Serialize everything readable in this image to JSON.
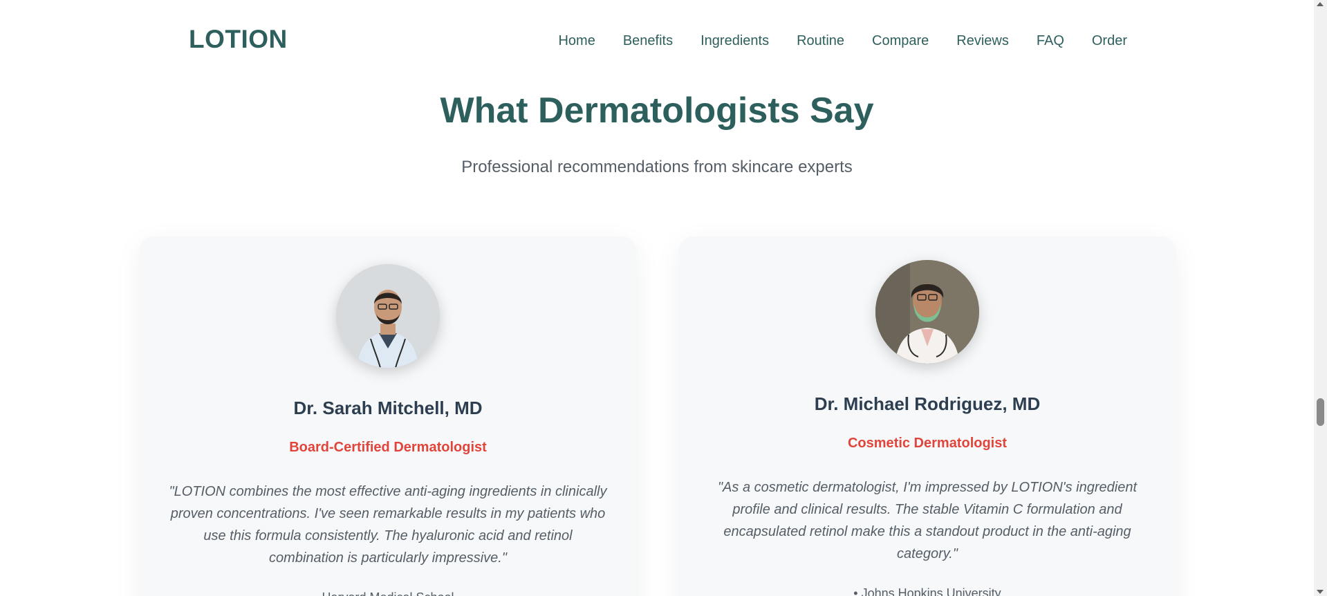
{
  "brand": {
    "logo": "LOTION"
  },
  "nav": {
    "items": [
      {
        "label": "Home"
      },
      {
        "label": "Benefits"
      },
      {
        "label": "Ingredients"
      },
      {
        "label": "Routine"
      },
      {
        "label": "Compare"
      },
      {
        "label": "Reviews"
      },
      {
        "label": "FAQ"
      },
      {
        "label": "Order"
      }
    ]
  },
  "section": {
    "title": "What Dermatologists Say",
    "subtitle": "Professional recommendations from skincare experts"
  },
  "cards": [
    {
      "name": "Dr. Sarah Mitchell, MD",
      "title": "Board-Certified Dermatologist",
      "quote": "\"LOTION combines the most effective anti-aging ingredients in clinically proven concentrations. I've seen remarkable results in my patients who use this formula consistently. The hyaluronic acid and retinol combination is particularly impressive.\"",
      "affiliation": "Harvard Medical School"
    },
    {
      "name": "Dr. Michael Rodriguez, MD",
      "title": "Cosmetic Dermatologist",
      "quote": "\"As a cosmetic dermatologist, I'm impressed by LOTION's ingredient profile and clinical results. The stable Vitamin C formulation and encapsulated retinol make this a standout product in the anti-aging category.\"",
      "affiliation": "• Johns Hopkins University"
    }
  ],
  "colors": {
    "brand": "#2d5f5d",
    "accent": "#e0443a",
    "card_bg": "#f6f8f9"
  }
}
